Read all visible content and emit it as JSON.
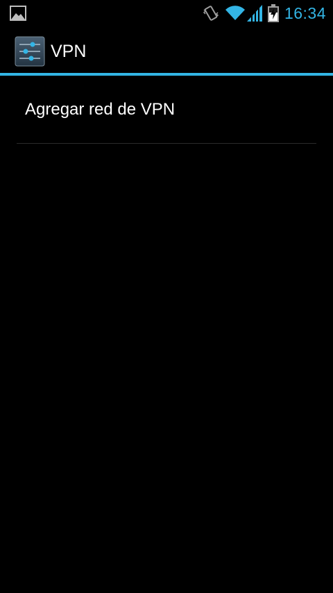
{
  "status_bar": {
    "notification_icon": "image-icon",
    "icons": [
      "vibrate-icon",
      "wifi-icon",
      "signal-icon",
      "battery-charging-icon"
    ],
    "time": "16:34",
    "accent_color": "#33b5e5"
  },
  "action_bar": {
    "icon": "settings-icon",
    "title": "VPN",
    "divider_color": "#33b5e5"
  },
  "list": {
    "items": [
      {
        "label": "Agregar red de VPN"
      }
    ]
  }
}
